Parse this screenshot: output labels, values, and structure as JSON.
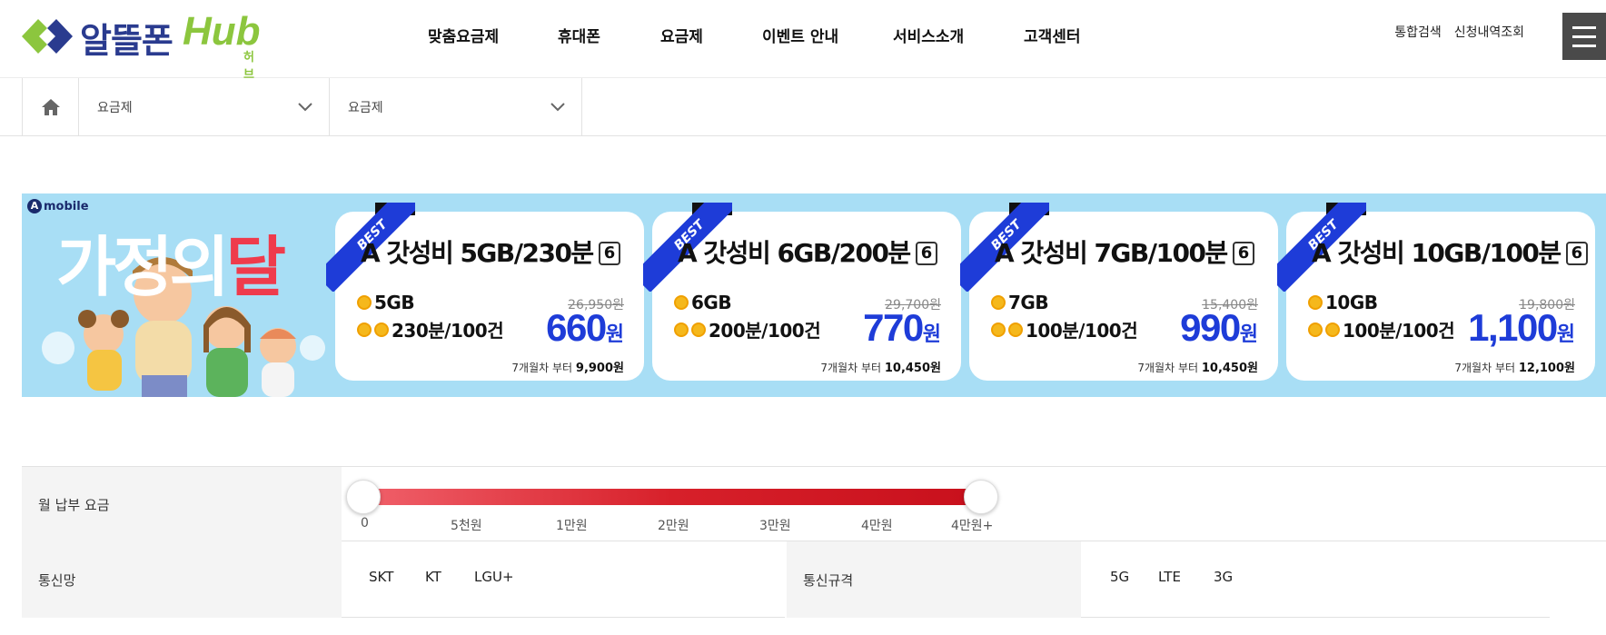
{
  "header": {
    "logo_kr": "알뜰폰",
    "logo_hub": "Hub",
    "logo_sub": "허브",
    "nav": [
      "맞춤요금제",
      "휴대폰",
      "요금제",
      "이벤트 안내",
      "서비스소개",
      "고객센터"
    ],
    "util": [
      "통합검색",
      "신청내역조회"
    ]
  },
  "breadcrumb": {
    "select1": "요금제",
    "select2": "요금제"
  },
  "banner": {
    "brand": "mobile",
    "title_white": "가정의",
    "title_red": "달",
    "ribbon": "BEST",
    "cards": [
      {
        "name": "A 갓성비 5GB/230분",
        "badge": "6",
        "data": "5GB",
        "voice": "230분/100건",
        "orig": "26,950원",
        "price": "660",
        "won": "원",
        "after_prefix": "7개월차 부터",
        "after_price": "9,900원"
      },
      {
        "name": "A 갓성비 6GB/200분",
        "badge": "6",
        "data": "6GB",
        "voice": "200분/100건",
        "orig": "29,700원",
        "price": "770",
        "won": "원",
        "after_prefix": "7개월차 부터",
        "after_price": "10,450원"
      },
      {
        "name": "A 갓성비 7GB/100분",
        "badge": "6",
        "data": "7GB",
        "voice": "100분/100건",
        "orig": "15,400원",
        "price": "990",
        "won": "원",
        "after_prefix": "7개월차 부터",
        "after_price": "10,450원"
      },
      {
        "name": "A 갓성비 10GB/100분",
        "badge": "6",
        "data": "10GB",
        "voice": "100분/100건",
        "orig": "19,800원",
        "price": "1,100",
        "won": "원",
        "after_prefix": "7개월차 부터",
        "after_price": "12,100원"
      }
    ]
  },
  "filter": {
    "fee_label": "월 납부 요금",
    "ticks": [
      "0",
      "5천원",
      "1만원",
      "2만원",
      "3만원",
      "4만원",
      "4만원+"
    ],
    "fee_range": {
      "min_index": 0,
      "max_index": 6
    },
    "network_label": "통신망",
    "networks": [
      "SKT",
      "KT",
      "LGU+"
    ],
    "standard_label": "통신규격",
    "standards": [
      "5G",
      "LTE",
      "3G"
    ]
  },
  "colors": {
    "brand_blue": "#2a3b8f",
    "brand_green": "#8cc63e",
    "price_blue": "#1e3cd8",
    "slider_red": "#d7202a",
    "banner_bg": "#a8def5"
  }
}
